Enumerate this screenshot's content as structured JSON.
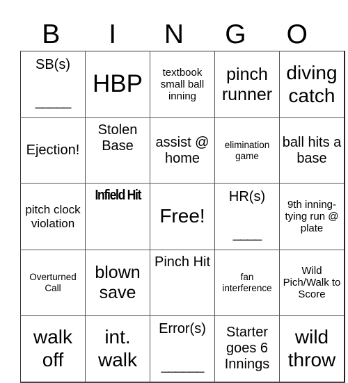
{
  "header": {
    "letters": [
      "B",
      "I",
      "N",
      "G",
      "O"
    ]
  },
  "grid": {
    "rows": [
      [
        {
          "text": "SB(s)",
          "blank": "_____"
        },
        {
          "text": "HBP"
        },
        {
          "text": "textbook small ball inning"
        },
        {
          "text": "pinch runner"
        },
        {
          "text": "diving catch"
        }
      ],
      [
        {
          "text": "Ejection!"
        },
        {
          "text": "Stolen Base"
        },
        {
          "text": "assist @ home"
        },
        {
          "text": "elimination game"
        },
        {
          "text": "ball hits a base"
        }
      ],
      [
        {
          "text": "pitch clock violation"
        },
        {
          "text": "Infield Hit"
        },
        {
          "text": "Free!"
        },
        {
          "text": "HR(s)",
          "blank": "____"
        },
        {
          "text": "9th inning-tying run @ plate"
        }
      ],
      [
        {
          "text": "Overturned Call"
        },
        {
          "text": "blown save"
        },
        {
          "text": "Pinch Hit"
        },
        {
          "text": "fan interference"
        },
        {
          "text": "Wild Pich/Walk to Score"
        }
      ],
      [
        {
          "text": "walk off"
        },
        {
          "text": "int. walk"
        },
        {
          "text": "Error(s)",
          "blank": "______"
        },
        {
          "text": "Starter goes 6 Innings"
        },
        {
          "text": "wild throw"
        }
      ]
    ]
  }
}
